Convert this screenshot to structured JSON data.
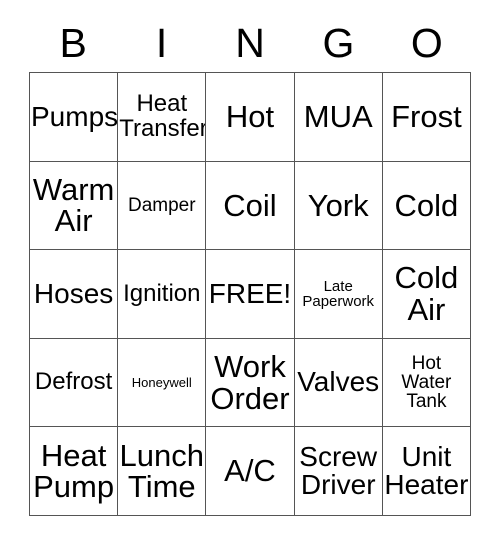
{
  "card": {
    "header_letters": [
      "B",
      "I",
      "N",
      "G",
      "O"
    ],
    "free_space_label": "FREE!",
    "rows": [
      [
        {
          "label": "Pumps",
          "size": "lg",
          "lines": 1
        },
        {
          "label": "Heat\nTransfer",
          "size": "md",
          "lines": 2
        },
        {
          "label": "Hot",
          "size": "xl",
          "lines": 1
        },
        {
          "label": "MUA",
          "size": "xl",
          "lines": 1
        },
        {
          "label": "Frost",
          "size": "xl",
          "lines": 1
        }
      ],
      [
        {
          "label": "Warm\nAir",
          "size": "xl",
          "lines": 2
        },
        {
          "label": "Damper",
          "size": "sm",
          "lines": 1
        },
        {
          "label": "Coil",
          "size": "xl",
          "lines": 1
        },
        {
          "label": "York",
          "size": "xl",
          "lines": 1
        },
        {
          "label": "Cold",
          "size": "xl",
          "lines": 1
        }
      ],
      [
        {
          "label": "Hoses",
          "size": "lg",
          "lines": 1
        },
        {
          "label": "Ignition",
          "size": "md",
          "lines": 1
        },
        {
          "label": "FREE!",
          "size": "lg",
          "lines": 1
        },
        {
          "label": "Late\nPaperwork",
          "size": "xs",
          "lines": 2
        },
        {
          "label": "Cold\nAir",
          "size": "xl",
          "lines": 2
        }
      ],
      [
        {
          "label": "Defrost",
          "size": "md",
          "lines": 1
        },
        {
          "label": "Honeywell",
          "size": "xxs",
          "lines": 1
        },
        {
          "label": "Work\nOrder",
          "size": "xl",
          "lines": 2
        },
        {
          "label": "Valves",
          "size": "lg",
          "lines": 1
        },
        {
          "label": "Hot\nWater\nTank",
          "size": "sm",
          "lines": 3
        }
      ],
      [
        {
          "label": "Heat\nPump",
          "size": "xl",
          "lines": 2
        },
        {
          "label": "Lunch\nTime",
          "size": "xl",
          "lines": 2
        },
        {
          "label": "A/C",
          "size": "xl",
          "lines": 1
        },
        {
          "label": "Screw\nDriver",
          "size": "lg",
          "lines": 2
        },
        {
          "label": "Unit\nHeater",
          "size": "lg",
          "lines": 2
        }
      ]
    ]
  },
  "colors": {
    "border": "#555555",
    "text": "#000000",
    "background": "#ffffff"
  }
}
